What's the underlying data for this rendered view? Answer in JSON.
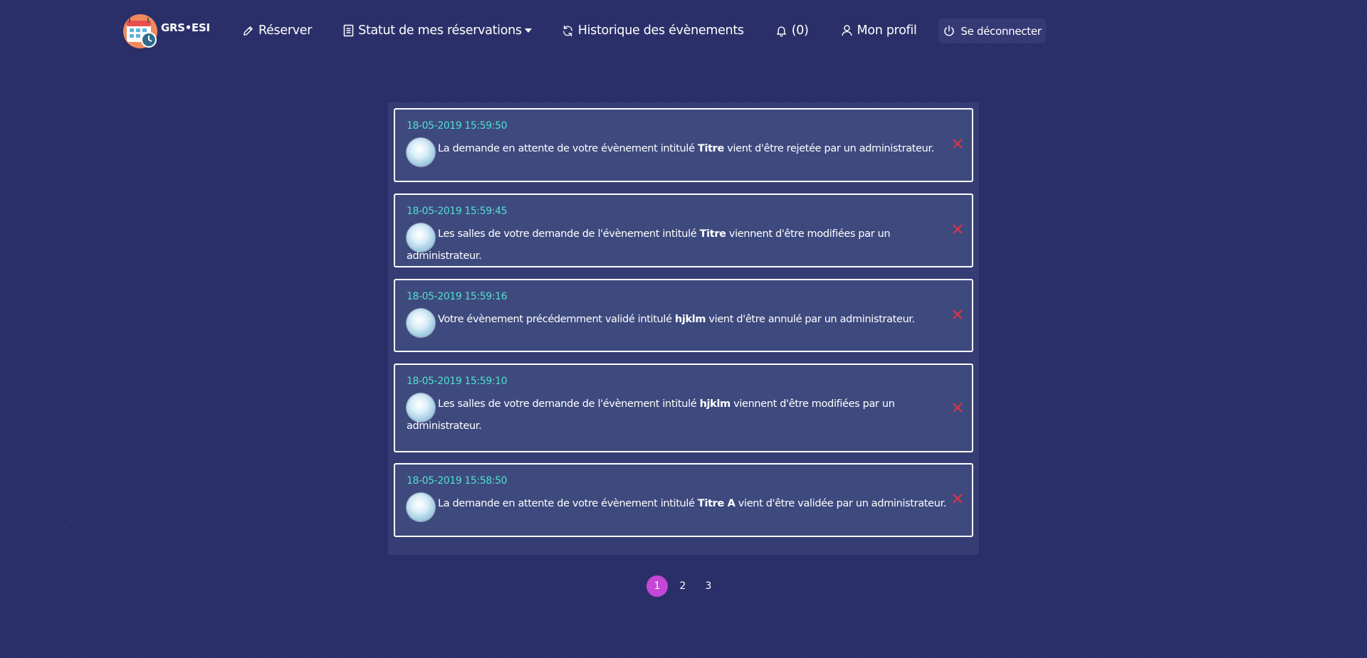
{
  "nav": {
    "brand": "GRS•ESI",
    "reserver": "Réserver",
    "statut": "Statut de mes réservations",
    "historique": "Historique des évènements",
    "notifications": "(0)",
    "profil": "Mon profil",
    "logout": "Se déconnecter"
  },
  "notifications": [
    {
      "date": "18-05-2019 15:59:50",
      "text_before": "La demande en attente de votre évènement intitulé ",
      "event": "Titre",
      "text_after": " vient d'être rejetée par un administrateur."
    },
    {
      "date": "18-05-2019 15:59:45",
      "text_before": "Les salles de votre demande de l'évènement intitulé ",
      "event": "Titre",
      "text_after": " viennent d'être modifiées par un administrateur."
    },
    {
      "date": "18-05-2019 15:59:16",
      "text_before": "Votre évènement précédemment validé intitulé ",
      "event": "hjklm",
      "text_after": " vient d'être annulé par un administrateur."
    },
    {
      "date": "18-05-2019 15:59:10",
      "text_before": "Les salles de votre demande de l'évènement intitulé ",
      "event": "hjklm",
      "text_after": " viennent d'être modifiées par un administrateur."
    },
    {
      "date": "18-05-2019 15:58:50",
      "text_before": "La demande en attente de votre évènement intitulé ",
      "event": "Titre A",
      "text_after": " vient d'être validée par un administrateur."
    }
  ],
  "pagination": {
    "pages": [
      "1",
      "2",
      "3"
    ],
    "current": "1"
  },
  "colors": {
    "background": "#2b2f69",
    "panel": "#363c74",
    "card": "#3e4a7e",
    "date": "#4fe0cf",
    "close": "#e0304a",
    "active_page": "#c447d6"
  },
  "icons": {
    "logo": "calendar-clock-logo",
    "reserver": "pencil-icon",
    "statut": "document-icon",
    "historique": "refresh-icon",
    "notifications": "bell-icon",
    "profil": "user-icon",
    "logout": "power-icon",
    "notification_avatar": "avatar-icon",
    "dismiss": "close-icon"
  }
}
